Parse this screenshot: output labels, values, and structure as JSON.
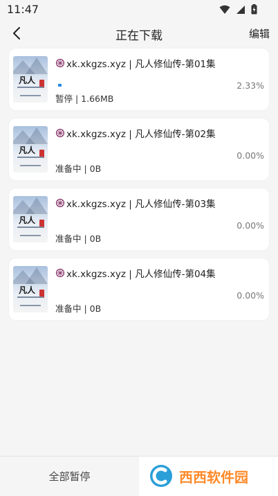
{
  "status_bar": {
    "time": "11:47"
  },
  "header": {
    "title": "正在下载",
    "edit_label": "编辑"
  },
  "downloads": [
    {
      "title": "xk.xkgzs.xyz | 凡人修仙传-第01集",
      "status": "暂停 | 1.66MB",
      "percent": "2.33%",
      "progress": 0.0233
    },
    {
      "title": "xk.xkgzs.xyz | 凡人修仙传-第02集",
      "status": "准备中 | 0B",
      "percent": "0.00%",
      "progress": 0
    },
    {
      "title": "xk.xkgzs.xyz | 凡人修仙传-第03集",
      "status": "准备中 | 0B",
      "percent": "0.00%",
      "progress": 0
    },
    {
      "title": "xk.xkgzs.xyz | 凡人修仙传-第04集",
      "status": "准备中 | 0B",
      "percent": "0.00%",
      "progress": 0
    }
  ],
  "thumbnail": {
    "title": "凡人"
  },
  "bottom": {
    "pause_all_label": "全部暂停"
  },
  "watermark": {
    "text": "西西软件园"
  },
  "colors": {
    "accent": "#1e88e5",
    "background": "#f5f5f5",
    "card": "#ffffff"
  }
}
